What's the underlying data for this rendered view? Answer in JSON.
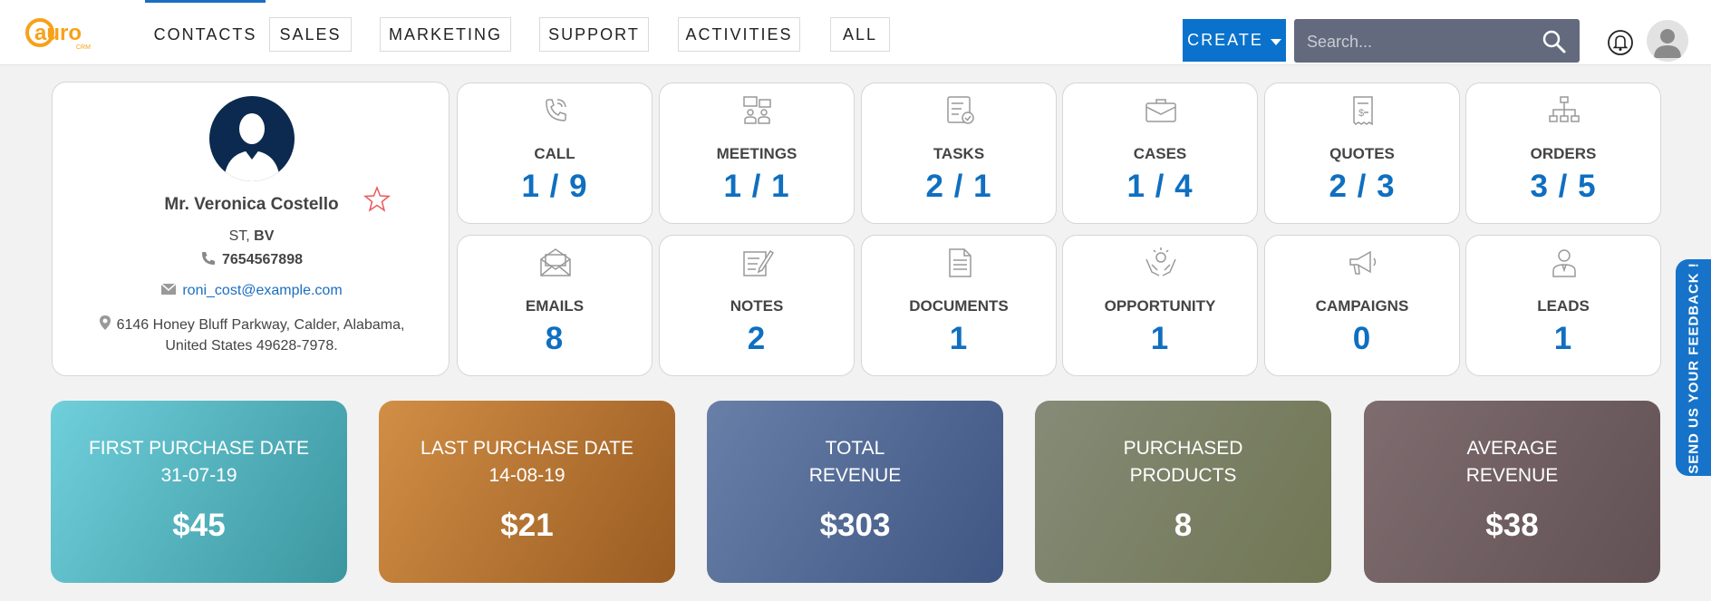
{
  "logo": {
    "text": "auro",
    "subtext": "CRM",
    "brand_color": "#f7a11a"
  },
  "nav": {
    "items": [
      {
        "label": "CONTACTS"
      },
      {
        "label": "SALES"
      },
      {
        "label": "MARKETING"
      },
      {
        "label": "SUPPORT"
      },
      {
        "label": "ACTIVITIES"
      },
      {
        "label": "ALL"
      }
    ],
    "active": "CONTACTS",
    "accent": "#1b6ec2"
  },
  "header": {
    "create_label": "CREATE",
    "search_placeholder": "Search...",
    "icons": [
      "search-icon",
      "bell-icon",
      "user-avatar"
    ]
  },
  "contact": {
    "name": "Mr. Veronica Costello",
    "title_prefix": "ST, ",
    "title_company": "BV",
    "phone": "7654567898",
    "email": "roni_cost@example.com",
    "address_line1": "6146 Honey Bluff Parkway, Calder, Alabama,",
    "address_line2": "United States 49628-7978."
  },
  "tiles": [
    {
      "label": "CALL",
      "value": "1 / 9",
      "icon": "phone-call-icon"
    },
    {
      "label": "MEETINGS",
      "value": "1 / 1",
      "icon": "meeting-icon"
    },
    {
      "label": "TASKS",
      "value": "2 / 1",
      "icon": "tasks-icon"
    },
    {
      "label": "CASES",
      "value": "1 / 4",
      "icon": "briefcase-icon"
    },
    {
      "label": "QUOTES",
      "value": "2 / 3",
      "icon": "receipt-icon"
    },
    {
      "label": "ORDERS",
      "value": "3 / 5",
      "icon": "hierarchy-icon"
    },
    {
      "label": "EMAILS",
      "value": "8",
      "icon": "envelope-icon"
    },
    {
      "label": "NOTES",
      "value": "2",
      "icon": "notes-icon"
    },
    {
      "label": "DOCUMENTS",
      "value": "1",
      "icon": "document-icon"
    },
    {
      "label": "OPPORTUNITY",
      "value": "1",
      "icon": "handshake-icon"
    },
    {
      "label": "CAMPAIGNS",
      "value": "0",
      "icon": "megaphone-icon"
    },
    {
      "label": "LEADS",
      "value": "1",
      "icon": "person-icon"
    }
  ],
  "metrics": [
    {
      "title1": "FIRST PURCHASE DATE",
      "title2": "31-07-19",
      "value": "$45",
      "color_from": "#6fcfdb",
      "color_to": "#3b969f"
    },
    {
      "title1": "LAST PURCHASE DATE",
      "title2": "14-08-19",
      "value": "$21",
      "color_from": "#d18e45",
      "color_to": "#9a5c22"
    },
    {
      "title1": "TOTAL",
      "title2": "REVENUE",
      "value": "$303",
      "color_from": "#6880a8",
      "color_to": "#3f5583"
    },
    {
      "title1": "PURCHASED",
      "title2": "PRODUCTS",
      "value": "8",
      "color_from": "#858b77",
      "color_to": "#717654"
    },
    {
      "title1": "AVERAGE",
      "title2": "REVENUE",
      "value": "$38",
      "color_from": "#7e6c6f",
      "color_to": "#625154"
    }
  ],
  "feedback": {
    "label": "SEND US YOUR FEEDBACK !"
  },
  "colors": {
    "value_blue": "#0f6fc0",
    "create_blue": "#0a72cc",
    "search_bg": "#636a7d"
  }
}
